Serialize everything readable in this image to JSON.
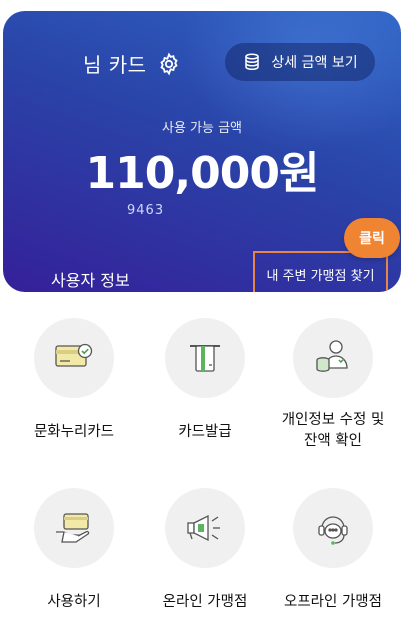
{
  "card": {
    "title": "님 카드",
    "detail_button": "상세 금액 보기",
    "available_label": "사용 가능 금액",
    "amount": "110,000원",
    "card_number": "9463",
    "user_info": "사용자 정보",
    "nearby_button": "내 주변 가맹점 찾기",
    "click_badge": "클릭",
    "accent_color": "#ef8432"
  },
  "menu": {
    "items": [
      {
        "label": "문화누리카드",
        "icon": "card-check-icon"
      },
      {
        "label": "카드발급",
        "icon": "card-issue-icon"
      },
      {
        "label_line1": "개인정보 수정 및",
        "label_line2": "잔액 확인",
        "icon": "person-coins-icon"
      },
      {
        "label": "사용하기",
        "icon": "hand-card-icon"
      },
      {
        "label": "온라인 가맹점",
        "icon": "megaphone-icon"
      },
      {
        "label": "오프라인 가맹점",
        "icon": "headset-icon"
      }
    ]
  }
}
